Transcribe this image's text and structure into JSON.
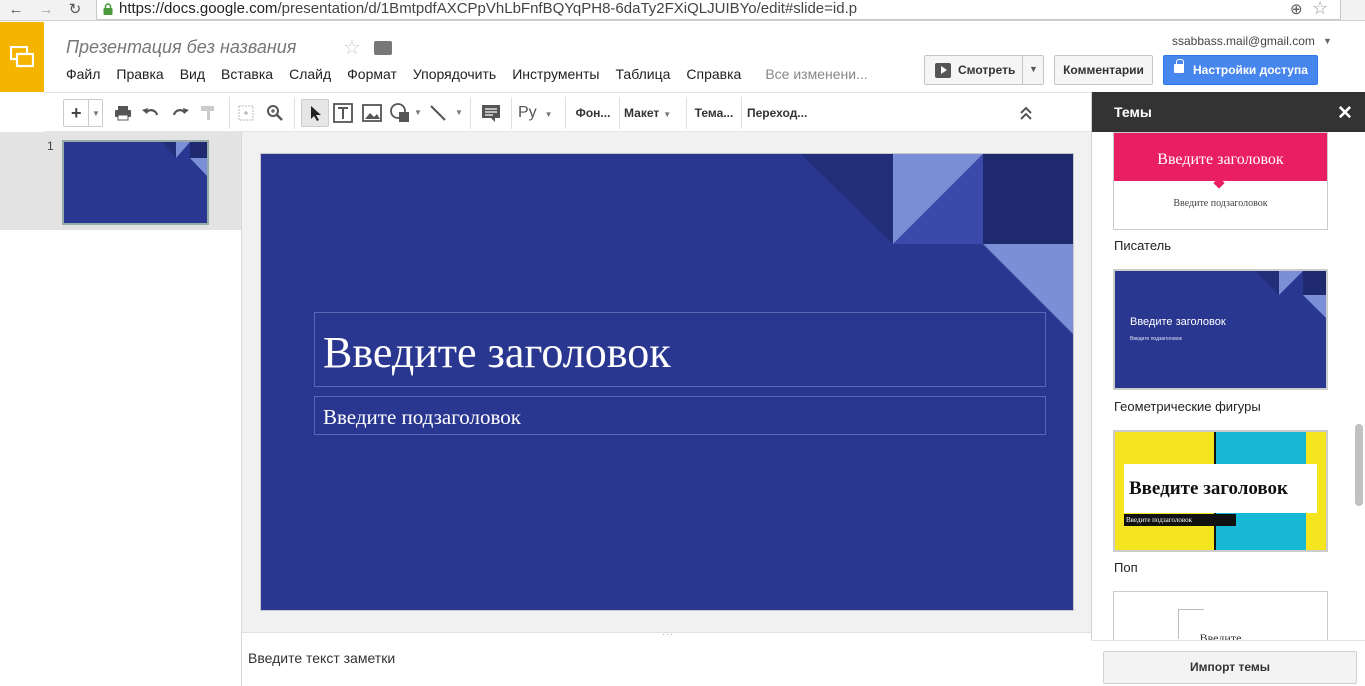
{
  "browser": {
    "url_host": "https://docs.google.com",
    "url_path": "/presentation/d/1BmtpdfAXCPpVhLbFnfBQYqPH8-6daTy2FXiQLJUIBYo/edit#slide=id.p"
  },
  "doc": {
    "title": "Презентация без названия",
    "user_email": "ssabbass.mail@gmail.com"
  },
  "menu": {
    "items": [
      "Файл",
      "Правка",
      "Вид",
      "Вставка",
      "Слайд",
      "Формат",
      "Упорядочить",
      "Инструменты",
      "Таблица",
      "Справка"
    ],
    "saved_status": "Все изменени..."
  },
  "header_buttons": {
    "present": "Смотреть",
    "comments": "Комментарии",
    "share": "Настройки доступа"
  },
  "toolbar": {
    "lang": "Ру",
    "background": "Фон...",
    "layout": "Макет",
    "theme": "Тема...",
    "transition": "Переход..."
  },
  "filmstrip": {
    "slides": [
      {
        "number": "1"
      }
    ]
  },
  "slide": {
    "title_placeholder": "Введите заголовок",
    "subtitle_placeholder": "Введите подзаголовок"
  },
  "notes": {
    "placeholder": "Введите текст заметки"
  },
  "themes_panel": {
    "title": "Темы",
    "themes": [
      {
        "name": "Писатель",
        "thumb_title": "Введите заголовок",
        "thumb_subtitle": "Введите подзаголовок"
      },
      {
        "name": "Геометрические фигуры",
        "thumb_title": "Введите заголовок",
        "thumb_subtitle": "Введите подзаголовок"
      },
      {
        "name": "Поп",
        "thumb_title": "Введите заголовок",
        "thumb_subtitle": "Введите подзаголовок"
      },
      {
        "thumb_title": "Введите"
      }
    ],
    "import_button": "Импорт темы"
  },
  "colors": {
    "app_accent": "#f4b400",
    "share_blue": "#4787ed",
    "slide_bg": "#2a3790",
    "writer_pink": "#e91e63",
    "pop_yellow": "#f5e51e",
    "pop_cyan": "#17b8d6"
  }
}
